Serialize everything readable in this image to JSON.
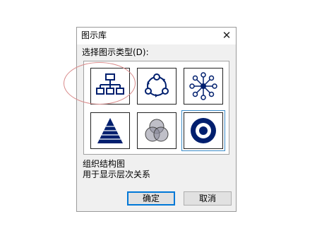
{
  "dialog": {
    "title": "图示库",
    "close_symbol": "✕",
    "prompt": "选择图示类型(D):",
    "diagram_types": [
      {
        "icon": "org-chart-icon"
      },
      {
        "icon": "cycle-diagram-icon"
      },
      {
        "icon": "radial-diagram-icon"
      },
      {
        "icon": "pyramid-diagram-icon"
      },
      {
        "icon": "venn-diagram-icon"
      },
      {
        "icon": "target-diagram-icon"
      }
    ],
    "selected_index": 5,
    "description_title": "组织结构图",
    "description_text": "用于显示层次关系",
    "ok_label": "确定",
    "cancel_label": "取消"
  },
  "colors": {
    "icon_navy": "#001f6e",
    "selection_blue": "#3c8cc8",
    "annotation_red": "#d98a8a",
    "default_button_border": "#0078d7"
  }
}
